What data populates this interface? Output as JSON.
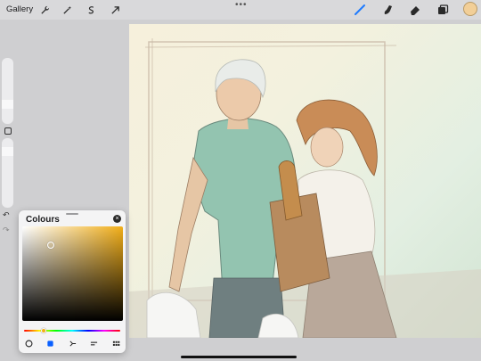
{
  "topbar": {
    "gallery_label": "Gallery",
    "left_tools": [
      "wrench-icon",
      "magic-wand-icon",
      "selection-icon",
      "transform-arrow-icon"
    ],
    "more_dots": "•••",
    "right_tools": [
      "brush-icon",
      "smudge-icon",
      "eraser-icon",
      "layers-icon"
    ],
    "current_colour": "#f2cf98"
  },
  "sidebar": {
    "undo_icon": "↶",
    "redo_icon": "↷",
    "modify_icon": "square-icon"
  },
  "colours_panel": {
    "title": "Colours",
    "close_icon": "×",
    "selected_hue": "#f1ae19",
    "hue_level": 0.2,
    "tabs": [
      "disc-icon",
      "classic-icon",
      "harmony-icon",
      "value-icon",
      "palettes-icon"
    ],
    "active_tab": "classic-icon"
  },
  "colors": {
    "accent": "#0a60ff",
    "toolbar_bg": "#d9d9db"
  }
}
